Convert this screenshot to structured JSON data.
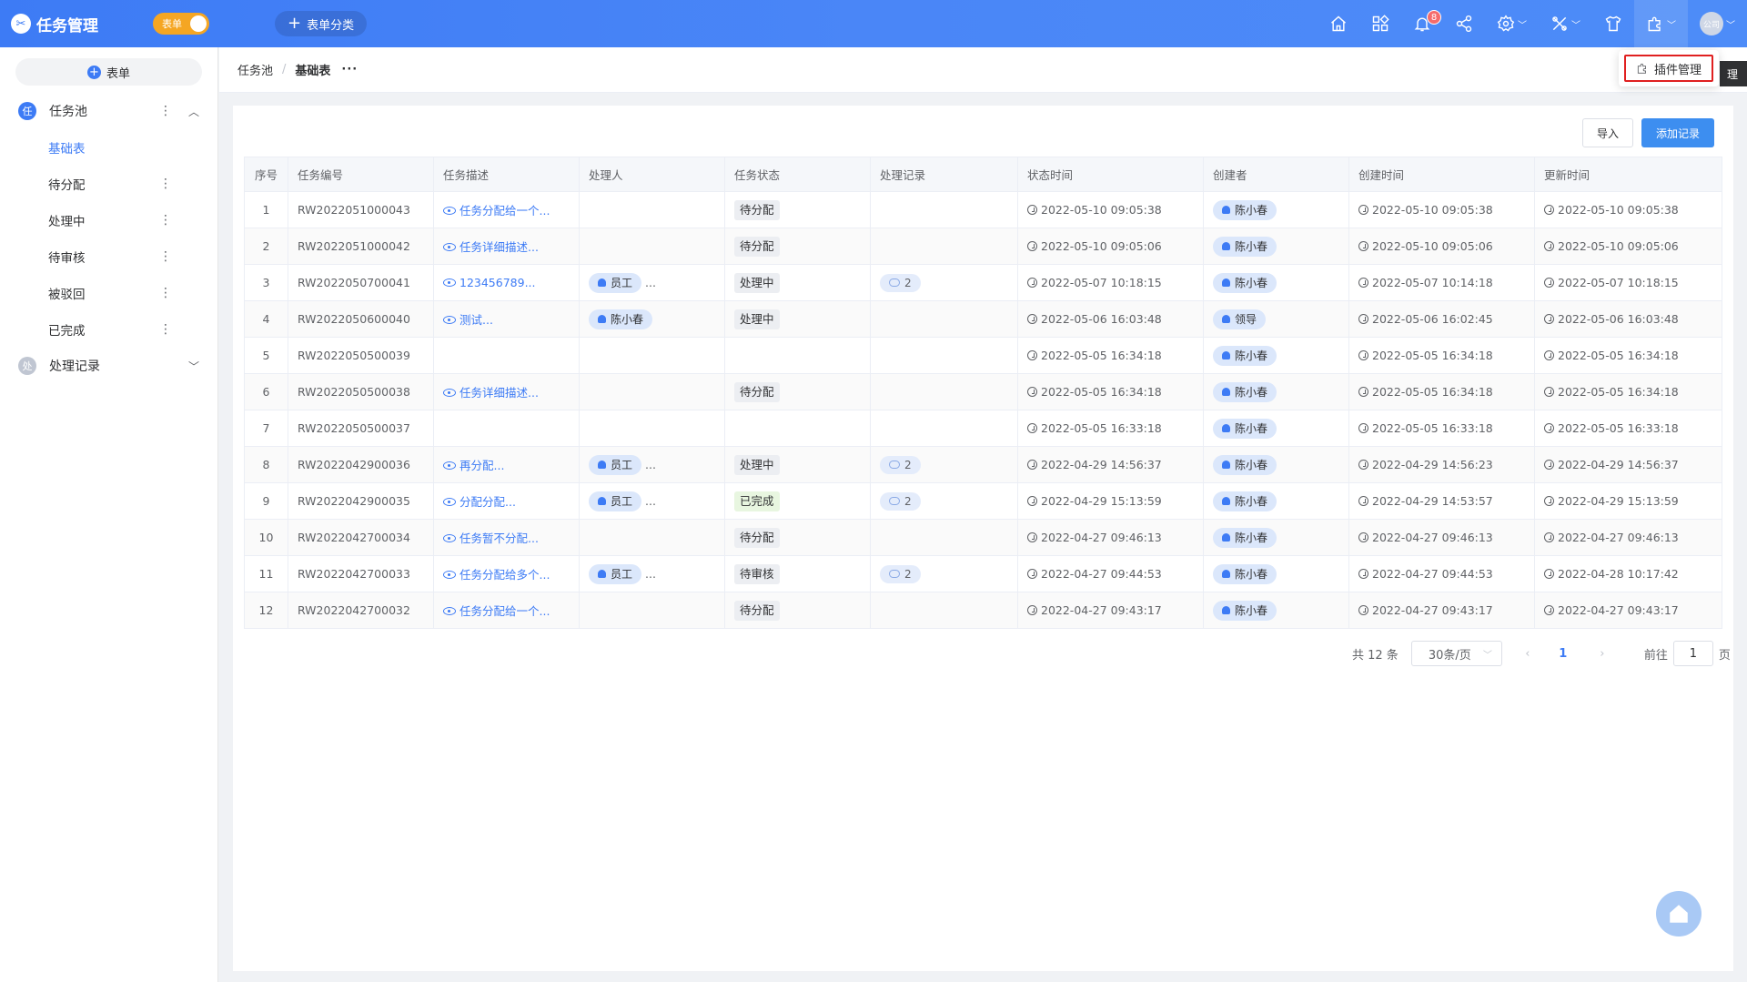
{
  "app": {
    "title": "任务管理",
    "toggle_label": "表单",
    "category_button": "表单分类"
  },
  "topbar": {
    "notification_count": "8",
    "avatar_text": "公司",
    "icons": [
      "home-icon",
      "apps-icon",
      "bell-icon",
      "share-icon",
      "settings-icon",
      "tools-icon",
      "shirt-icon",
      "plugin-icon",
      "avatar"
    ]
  },
  "dropdown": {
    "item": "插件管理",
    "dark_tab": "理"
  },
  "sidebar": {
    "add_label": "表单",
    "groups": [
      {
        "icon_text": "任",
        "label": "任务池",
        "color": "#3d7bf5"
      },
      {
        "icon_text": "处",
        "label": "处理记录",
        "color": "#c0c6d2"
      }
    ],
    "items": [
      "基础表",
      "待分配",
      "处理中",
      "待审核",
      "被驳回",
      "已完成"
    ]
  },
  "breadcrumb": {
    "root": "任务池",
    "sep": "/",
    "current": "基础表",
    "dots": "···"
  },
  "toolbar": {
    "import": "导入",
    "add": "添加记录"
  },
  "table": {
    "headers": [
      "序号",
      "任务编号",
      "任务描述",
      "处理人",
      "任务状态",
      "处理记录",
      "状态时间",
      "创建者",
      "创建时间",
      "更新时间"
    ],
    "rows": [
      {
        "no": "1",
        "id": "RW2022051000043",
        "desc": "任务分配给一个...",
        "handler": "",
        "status": "待分配",
        "records": "",
        "status_time": "2022-05-10 09:05:38",
        "creator": "陈小春",
        "created": "2022-05-10 09:05:38",
        "updated": "2022-05-10 09:05:38"
      },
      {
        "no": "2",
        "id": "RW2022051000042",
        "desc": "任务详细描述...",
        "handler": "",
        "status": "待分配",
        "records": "",
        "status_time": "2022-05-10 09:05:06",
        "creator": "陈小春",
        "created": "2022-05-10 09:05:06",
        "updated": "2022-05-10 09:05:06"
      },
      {
        "no": "3",
        "id": "RW2022050700041",
        "desc": "123456789...",
        "handler": "员工",
        "status": "处理中",
        "records": "2",
        "status_time": "2022-05-07 10:18:15",
        "creator": "陈小春",
        "created": "2022-05-07 10:14:18",
        "updated": "2022-05-07 10:18:15"
      },
      {
        "no": "4",
        "id": "RW2022050600040",
        "desc": "测试...",
        "handler": "陈小春",
        "status": "处理中",
        "records": "",
        "status_time": "2022-05-06 16:03:48",
        "creator": "领导",
        "created": "2022-05-06 16:02:45",
        "updated": "2022-05-06 16:03:48"
      },
      {
        "no": "5",
        "id": "RW2022050500039",
        "desc": "",
        "handler": "",
        "status": "",
        "records": "",
        "status_time": "2022-05-05 16:34:18",
        "creator": "陈小春",
        "created": "2022-05-05 16:34:18",
        "updated": "2022-05-05 16:34:18"
      },
      {
        "no": "6",
        "id": "RW2022050500038",
        "desc": "任务详细描述...",
        "handler": "",
        "status": "待分配",
        "records": "",
        "status_time": "2022-05-05 16:34:18",
        "creator": "陈小春",
        "created": "2022-05-05 16:34:18",
        "updated": "2022-05-05 16:34:18"
      },
      {
        "no": "7",
        "id": "RW2022050500037",
        "desc": "",
        "handler": "",
        "status": "",
        "records": "",
        "status_time": "2022-05-05 16:33:18",
        "creator": "陈小春",
        "created": "2022-05-05 16:33:18",
        "updated": "2022-05-05 16:33:18"
      },
      {
        "no": "8",
        "id": "RW2022042900036",
        "desc": "再分配...",
        "handler": "员工",
        "status": "处理中",
        "records": "2",
        "status_time": "2022-04-29 14:56:37",
        "creator": "陈小春",
        "created": "2022-04-29 14:56:23",
        "updated": "2022-04-29 14:56:37"
      },
      {
        "no": "9",
        "id": "RW2022042900035",
        "desc": "分配分配...",
        "handler": "员工",
        "status": "已完成",
        "records": "2",
        "status_time": "2022-04-29 15:13:59",
        "creator": "陈小春",
        "created": "2022-04-29 14:53:57",
        "updated": "2022-04-29 15:13:59"
      },
      {
        "no": "10",
        "id": "RW2022042700034",
        "desc": "任务暂不分配...",
        "handler": "",
        "status": "待分配",
        "records": "",
        "status_time": "2022-04-27 09:46:13",
        "creator": "陈小春",
        "created": "2022-04-27 09:46:13",
        "updated": "2022-04-27 09:46:13"
      },
      {
        "no": "11",
        "id": "RW2022042700033",
        "desc": "任务分配给多个...",
        "handler": "员工",
        "status": "待审核",
        "records": "2",
        "status_time": "2022-04-27 09:44:53",
        "creator": "陈小春",
        "created": "2022-04-27 09:44:53",
        "updated": "2022-04-28 10:17:42"
      },
      {
        "no": "12",
        "id": "RW2022042700032",
        "desc": "任务分配给一个...",
        "handler": "",
        "status": "待分配",
        "records": "",
        "status_time": "2022-04-27 09:43:17",
        "creator": "陈小春",
        "created": "2022-04-27 09:43:17",
        "updated": "2022-04-27 09:43:17"
      }
    ],
    "handler_more": "..."
  },
  "pagination": {
    "total": "共 12 条",
    "page_size": "30条/页",
    "current": "1",
    "goto_label": "前往",
    "goto_value": "1",
    "page_suffix": "页"
  },
  "colors": {
    "primary": "#3d7bf5",
    "toggle": "#f5a623",
    "highlight": "#e02020"
  }
}
